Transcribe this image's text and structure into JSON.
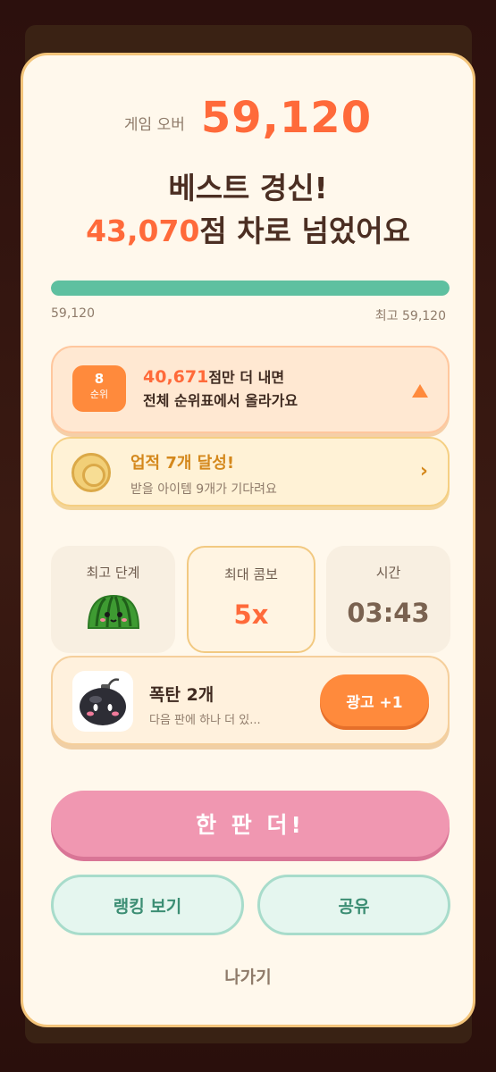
{
  "gameover": {
    "label": "게임 오버",
    "score": "59,120"
  },
  "headline": {
    "line1": "베스트 경신!",
    "diff": "43,070",
    "line2_rest": "점 차로 넘었어요"
  },
  "progress": {
    "left_label": "59,120",
    "right_label": "최고 59,120",
    "fraction": 1.0
  },
  "rank": {
    "number": "8",
    "unit": "순위",
    "points": "40,671",
    "line1_rest": "점만 더 내면",
    "line2": "전체 순위표에서 올라가요",
    "icon": "triangle-up-icon"
  },
  "achievement": {
    "title": "업적 7개 달성!",
    "subtitle": "받을 아이템 9개가 기다려요",
    "chevron": "›",
    "icon": "coin-icon"
  },
  "stats": [
    {
      "label": "최고 단계",
      "icon": "watermelon-icon"
    },
    {
      "label": "최대 콤보",
      "value": "5x"
    },
    {
      "label": "시간",
      "value": "03:43"
    }
  ],
  "item": {
    "title": "폭탄 2개",
    "subtitle": "다음 판에 하나 더 있...",
    "button": "광고 +1",
    "icon": "bomb-icon"
  },
  "buttons": {
    "again": "한 판 더!",
    "ranking": "랭킹 보기",
    "share": "공유",
    "exit": "나가기"
  },
  "colors": {
    "accent": "#ff6a3a",
    "progress": "#5ec0a0",
    "again": "#f097b1",
    "ad": "#ff8a3c"
  }
}
